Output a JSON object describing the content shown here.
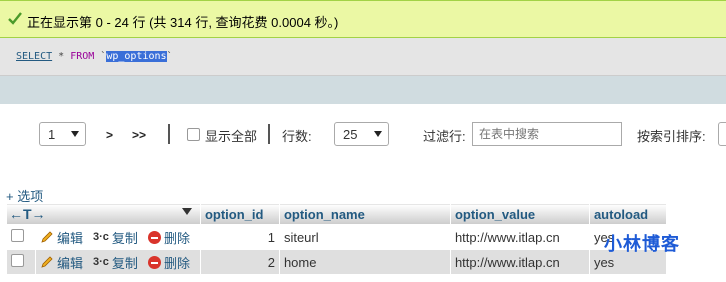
{
  "status": {
    "message": "正在显示第 0 - 24 行 (共 314 行, 查询花费 0.0004 秒。)"
  },
  "sql": {
    "select": "SELECT",
    "star": " * ",
    "from": "FROM",
    "quote_open": " `",
    "table": "wp_options",
    "quote_close": "`"
  },
  "nav": {
    "page_value": "1",
    "next_label": ">",
    "last_label": ">>",
    "show_all_label": "显示全部",
    "rows_label": "行数:",
    "rows_value": "25",
    "filter_label": "过滤行:",
    "filter_placeholder": "在表中搜索",
    "sort_label": "按索引排序:"
  },
  "options_link": "+ 选项",
  "table": {
    "columns": [
      "option_id",
      "option_name",
      "option_value",
      "autoload"
    ],
    "action_labels": {
      "edit": "编辑",
      "copy": "复制",
      "delete": "删除"
    },
    "rows": [
      {
        "option_id": "1",
        "option_name": "siteurl",
        "option_value": "http://www.itlap.cn",
        "autoload": "yes"
      },
      {
        "option_id": "2",
        "option_name": "home",
        "option_value": "http://www.itlap.cn",
        "autoload": "yes"
      }
    ]
  },
  "watermark": "小林博客",
  "colors": {
    "success_bg": "#ebf8a4",
    "link": "#235a81",
    "delete": "#d9342b",
    "watermark": "#1e5bd6"
  }
}
